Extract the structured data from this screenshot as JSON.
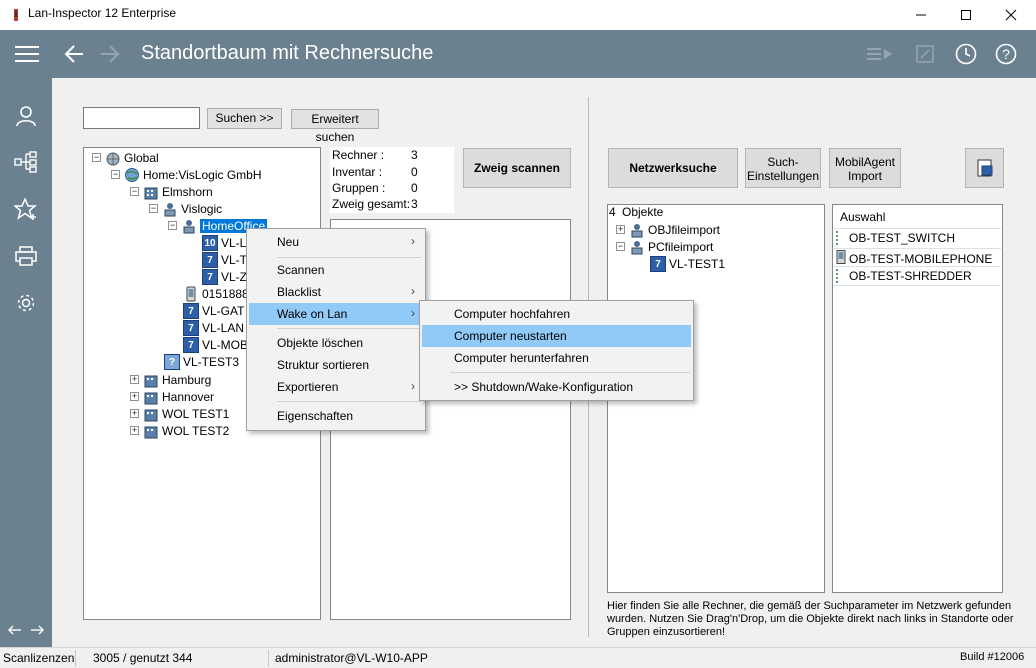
{
  "window": {
    "title": "Lan-Inspector 12 Enterprise"
  },
  "header": {
    "title": "Standortbaum mit Rechnersuche"
  },
  "search": {
    "value": "",
    "search_button": "Suchen >>",
    "advanced_button": "Erweitert suchen"
  },
  "tree": {
    "global": "Global",
    "home": "Home:VisLogic GmbH",
    "elmshorn": "Elmshorn",
    "vislogic": "Vislogic",
    "homeoffice": "HomeOffice",
    "vl1": "VL-L",
    "vl2": "VL-T",
    "vl3": "VL-Z",
    "phone": "0151888",
    "gat": "VL-GAT",
    "lan": "VL-LAN",
    "mob": "VL-MOB",
    "test3": "VL-TEST3",
    "hamburg": "Hamburg",
    "hannover": "Hannover",
    "wol1": "WOL TEST1",
    "wol2": "WOL TEST2"
  },
  "stats": {
    "rechner_label": "Rechner  :",
    "rechner_value": "3",
    "inventar_label": "Inventar  :",
    "inventar_value": "0",
    "gruppen_label": "Gruppen  :",
    "gruppen_value": "0",
    "zweig_label": "Zweig gesamt:",
    "zweig_value": "3",
    "scan_button": "Zweig scannen"
  },
  "right": {
    "netzwerksuche": "Netzwerksuche",
    "such_einstellungen_1": "Such-",
    "such_einstellungen_2": "Einstellungen",
    "mobilagent_1": "MobilAgent",
    "mobilagent_2": "Import",
    "objects_count": "4",
    "objects_label": "Objekte",
    "obj1": "OBJfileimport",
    "obj2": "PCfileimport",
    "obj3": "VL-TEST1",
    "auswahl": "Auswahl",
    "sel1": "OB-TEST_SWITCH",
    "sel2": "OB-TEST-MOBILEPHONE",
    "sel3": "OB-TEST-SHREDDER",
    "help_text_1": "Hier finden Sie alle Rechner, die gemäß der Suchparameter im Netzwerk gefunden",
    "help_text_2": "wurden. Nutzen Sie Drag'n'Drop, um die Objekte direkt nach links in Standorte oder",
    "help_text_3": "Gruppen einzusortieren!"
  },
  "context_menu": {
    "neu": "Neu",
    "scannen": "Scannen",
    "blacklist": "Blacklist",
    "wake": "Wake on Lan",
    "loeschen": "Objekte löschen",
    "sortieren": "Struktur sortieren",
    "exportieren": "Exportieren",
    "eigenschaften": "Eigenschaften"
  },
  "submenu": {
    "hochfahren": "Computer hochfahren",
    "neustarten": "Computer neustarten",
    "herunterfahren": "Computer herunterfahren",
    "config": ">> Shutdown/Wake-Konfiguration"
  },
  "status": {
    "label": "Scanlizenzen",
    "licenses": "3005 / genutzt 344",
    "user": "administrator@VL-W10-APP",
    "build": "Build #12006"
  },
  "colors": {
    "header": "#6b8190",
    "selection": "#0078d7",
    "menu_highlight": "#91c9f7"
  }
}
